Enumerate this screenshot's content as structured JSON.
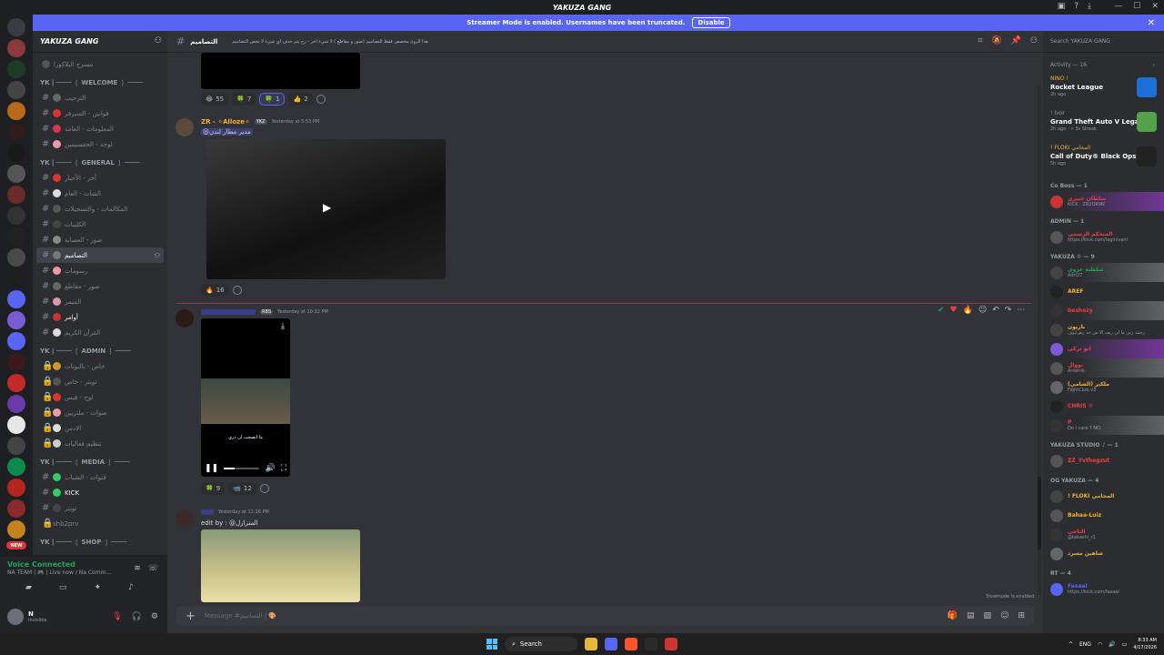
{
  "window": {
    "title": "YAKUZA GANG"
  },
  "streamer": {
    "text": "Streamer Mode is enabled. Usernames have been truncated.",
    "button": "Disable"
  },
  "server": {
    "name": "YAKUZA GANG"
  },
  "channels": {
    "top": "مسرح البلاكورا",
    "cat_welcome": "YK | ──── ❲ WELCOME ❳ ────",
    "welcome": [
      "الترحيب",
      "قوانين - السيرفر",
      "المعلومات - العامة",
      "لوحة - الحقسيمين"
    ],
    "cat_general": "YK | ──── ❲ GENERAL ❳ ────",
    "general": [
      "أخر - الأخبار",
      "الشات - العام",
      "المكالمات - والتسجيلات",
      "الكليبات",
      "صور - العصابة",
      "التصاميم",
      "رسومات",
      "صور - مقاطع",
      "الميمز",
      "أوامر",
      "القرآن الكريم"
    ],
    "active": "التصاميم",
    "cat_admin": "YK | ──── ❲ ADMIN ❳ ────",
    "admin": [
      "خاص - بالبوتات",
      "تويتر - خاص",
      "لوج - فيس",
      "صوات - ملتريين",
      "الادمن",
      "تنظيم فعاليات"
    ],
    "cat_media": "YK | ──── ❲ MEDIA ❳ ────",
    "media": [
      "قنوات - الشباب",
      "KICK",
      "تويتر",
      "shb2prv"
    ],
    "cat_shop": "YK | ──── ❲ SHOP ❳ ────"
  },
  "voice": {
    "status": "Voice Connected",
    "sub": "NA TEAM | 🎮 | Live now / Na Comm..."
  },
  "user": {
    "name": "N",
    "status": "Invisible"
  },
  "header": {
    "channel": "التصاميم",
    "topic": "هذا الروم مخصص فقط للتصاميم (صور و مقاطع ) لا شيء اخر - رح يتم حذف اي شيء لا يخص التصاميم"
  },
  "search": {
    "placeholder": "Search YAKUZA GANG"
  },
  "messages": {
    "r1": [
      {
        "e": "😂",
        "n": "55"
      },
      {
        "e": "🍀",
        "n": "7"
      },
      {
        "e": "🍀",
        "n": "1"
      },
      {
        "e": "👍",
        "n": "2"
      }
    ],
    "m2": {
      "author": "ZR - ✧Alloze✧",
      "tag": "YKZ",
      "time": "Yesterday at 5:53 PM",
      "text": "@مدير مطار لندن"
    },
    "r2": [
      {
        "e": "🔥",
        "n": "16"
      }
    ],
    "m3": {
      "author": "",
      "tag": "RBS",
      "time": "Yesterday at 10:32 PM",
      "caption": "ما انصحب ان ذري"
    },
    "r3": [
      {
        "e": "🍀",
        "n": "9"
      },
      {
        "e": "📹",
        "n": "12"
      }
    ],
    "m4": {
      "author": "",
      "time": "Yesterday at 11:16 PM",
      "text": "edit by : @المتزازل"
    }
  },
  "composer": {
    "placeholder": "Message #التصاميم | 🎨",
    "slowmode": "Slowmode is enabled."
  },
  "activity": {
    "head": "Activity — 16",
    "items": [
      {
        "name": "NINO !",
        "game": "Rocket League",
        "sub": "2h ago",
        "color": "#1d6fd6"
      },
      {
        "name": "! lvor",
        "game": "Grand Theft Auto V Legacy",
        "sub": "2h ago · ⚡ 3x Streak",
        "color": "#55a04a"
      },
      {
        "name": "! FLOKI المحامي",
        "game": "Call of Duty® Black Ops 7",
        "sub": "5h ago",
        "color": "#222"
      }
    ]
  },
  "members": {
    "role1": "Co Boss — 1",
    "co_boss": [
      {
        "name": "سلطان خبيري",
        "sub": "KICK : ZR2OR9N",
        "color": "#f23f43"
      }
    ],
    "role2": "ADMIN — 1",
    "admin": [
      {
        "name": "المتحكم الرسمي",
        "sub": "https://kick.com/loginivani",
        "color": "#f23f43"
      }
    ],
    "role3": "YAKUZA ♔ — 9",
    "yakuza": [
      {
        "name": "سلطنة عزوي",
        "sub": "Adri27",
        "color": "#23a55a"
      },
      {
        "name": "AREF",
        "sub": "",
        "color": "#f0b232"
      },
      {
        "name": "beshezy",
        "sub": "",
        "color": "#f23f43"
      },
      {
        "name": "باريون",
        "sub": "رحمة ربي ما لي ريف الا ش حد زهرانوف",
        "color": "#f0b232"
      },
      {
        "name": "ابو تركي",
        "sub": "",
        "color": "#f23f43"
      },
      {
        "name": "نووال",
        "sub": "Arsenik",
        "color": "#f23f43"
      },
      {
        "name": "ملكبر (الشامي)",
        "sub": "FightClub v3",
        "color": "#f0b232"
      },
      {
        "name": "CHRIS ♔",
        "sub": "",
        "color": "#f23f43"
      },
      {
        "name": "P",
        "sub": "Do I care ? NO.",
        "color": "#f23f43"
      }
    ],
    "role4": "YAKUZA STUDIO ♪ — 1",
    "studio": [
      {
        "name": "ZZ_Yvthegzut",
        "sub": "",
        "color": "#f23f43"
      }
    ],
    "role5": "OG YAKUZA — 4",
    "og": [
      {
        "name": "! FLOKI المحامي",
        "sub": "",
        "color": "#f0b232"
      },
      {
        "name": "Bahaa-Luiz",
        "sub": "",
        "color": "#f0b232"
      },
      {
        "name": "التاجي",
        "sub": "@takashi_r1",
        "color": "#f23f43"
      },
      {
        "name": "شاهين مسرد",
        "sub": "",
        "color": "#f0b232"
      }
    ],
    "role6": "RT — 4",
    "rt": [
      {
        "name": "Fasaal",
        "sub": "https://kick.com/fasaal",
        "color": "#5865f2"
      }
    ]
  },
  "taskbar": {
    "search": "Search",
    "lang": "ENG",
    "time": "8:33 AM",
    "date": "4/17/2026"
  }
}
